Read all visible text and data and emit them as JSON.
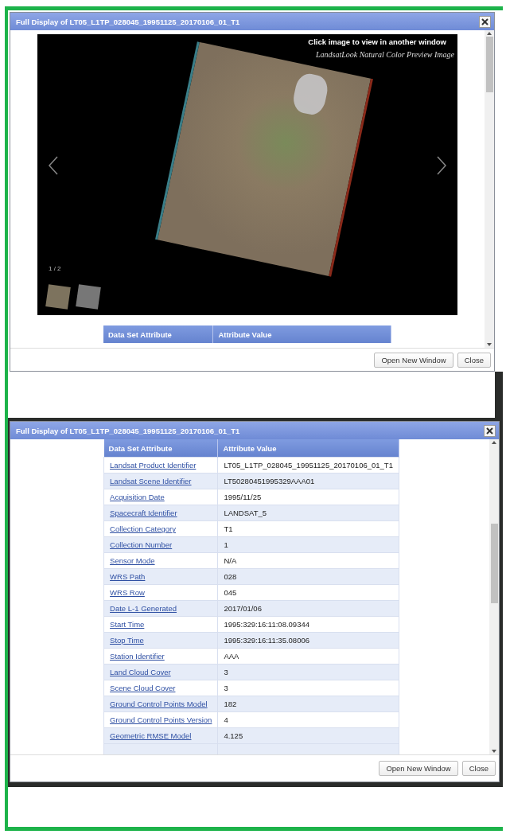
{
  "dialogs": [
    {
      "title": "Full Display of LT05_L1TP_028045_19951125_20170106_01_T1",
      "preview": {
        "caption": "Click image to view in another window",
        "subtitle": "LandsatLook Natural Color Preview Image",
        "counter": "1 / 2"
      },
      "table": {
        "columns": [
          "Data Set Attribute",
          "Attribute Value"
        ]
      },
      "buttons": [
        "Open New Window",
        "Close"
      ]
    },
    {
      "title": "Full Display of LT05_L1TP_028045_19951125_20170106_01_T1",
      "table": {
        "columns": [
          "Data Set Attribute",
          "Attribute Value"
        ],
        "rows": [
          {
            "attribute": "Landsat Product Identifier",
            "value": "LT05_L1TP_028045_19951125_20170106_01_T1"
          },
          {
            "attribute": "Landsat Scene Identifier",
            "value": "LT50280451995329AAA01"
          },
          {
            "attribute": "Acquisition Date",
            "value": "1995/11/25"
          },
          {
            "attribute": "Spacecraft Identifier",
            "value": "LANDSAT_5"
          },
          {
            "attribute": "Collection Category",
            "value": "T1"
          },
          {
            "attribute": "Collection Number",
            "value": "1"
          },
          {
            "attribute": "Sensor Mode",
            "value": "N/A"
          },
          {
            "attribute": "WRS Path",
            "value": "028"
          },
          {
            "attribute": "WRS Row",
            "value": "045"
          },
          {
            "attribute": "Date L-1 Generated",
            "value": "2017/01/06"
          },
          {
            "attribute": "Start Time",
            "value": "1995:329:16:11:08.09344"
          },
          {
            "attribute": "Stop Time",
            "value": "1995:329:16:11:35.08006"
          },
          {
            "attribute": "Station Identifier",
            "value": "AAA"
          },
          {
            "attribute": "Land Cloud Cover",
            "value": "3"
          },
          {
            "attribute": "Scene Cloud Cover",
            "value": "3"
          },
          {
            "attribute": "Ground Control Points Model",
            "value": "182"
          },
          {
            "attribute": "Ground Control Points Version",
            "value": "4"
          },
          {
            "attribute": "Geometric RMSE Model",
            "value": "4.125"
          }
        ]
      },
      "buttons": [
        "Open New Window",
        "Close"
      ]
    }
  ]
}
